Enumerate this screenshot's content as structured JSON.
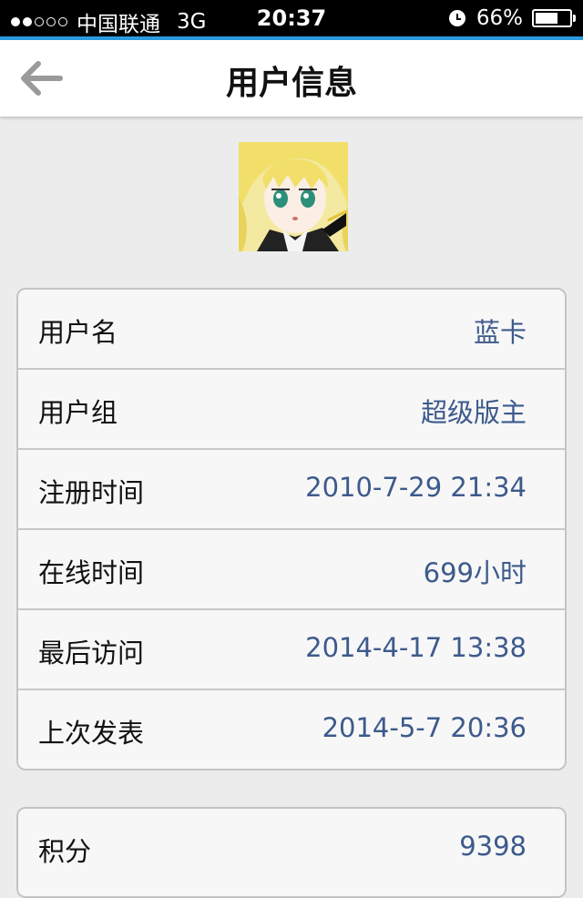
{
  "status_bar": {
    "signal_bars": 2,
    "carrier": "中国联通",
    "network": "3G",
    "time": "20:37",
    "battery_text": "66%",
    "battery_level": 0.66
  },
  "nav": {
    "title": "用户信息"
  },
  "profile_rows": [
    {
      "label": "用户名",
      "value": "蓝卡"
    },
    {
      "label": "用户组",
      "value": "超级版主"
    },
    {
      "label": "注册时间",
      "value": "2010-7-29 21:34"
    },
    {
      "label": "在线时间",
      "value": "699小时"
    },
    {
      "label": "最后访问",
      "value": "2014-4-17 13:38"
    },
    {
      "label": "上次发表",
      "value": "2014-5-7 20:36"
    }
  ],
  "stats_rows": [
    {
      "label": "积分",
      "value": "9398"
    }
  ],
  "colors": {
    "accent": "#2a9be0",
    "value_text": "#3d5a8c",
    "background": "#ececec"
  }
}
